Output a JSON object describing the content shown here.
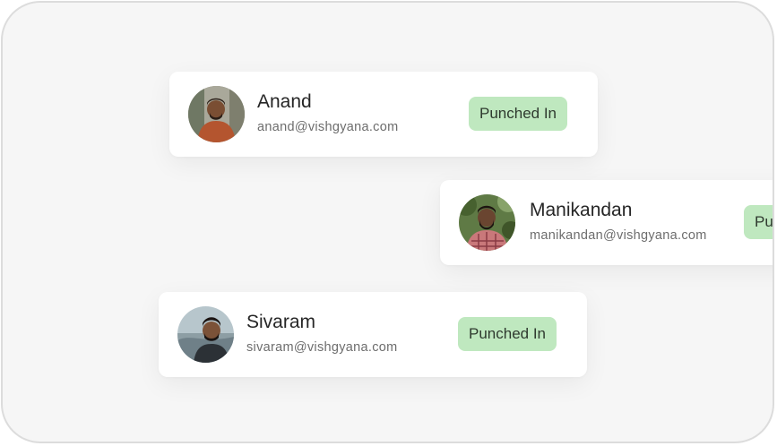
{
  "employees": [
    {
      "name": "Anand",
      "email": "anand@vishgyana.com",
      "status": "Punched In"
    },
    {
      "name": "Manikandan",
      "email": "manikandan@vishgyana.com",
      "status": "Punched In"
    },
    {
      "name": "Sivaram",
      "email": "sivaram@vishgyana.com",
      "status": "Punched In"
    }
  ],
  "colors": {
    "badge_bg": "#bfe8bf",
    "badge_text": "#2f3a2f",
    "card_bg": "#ffffff",
    "page_bg": "#f6f6f6"
  }
}
